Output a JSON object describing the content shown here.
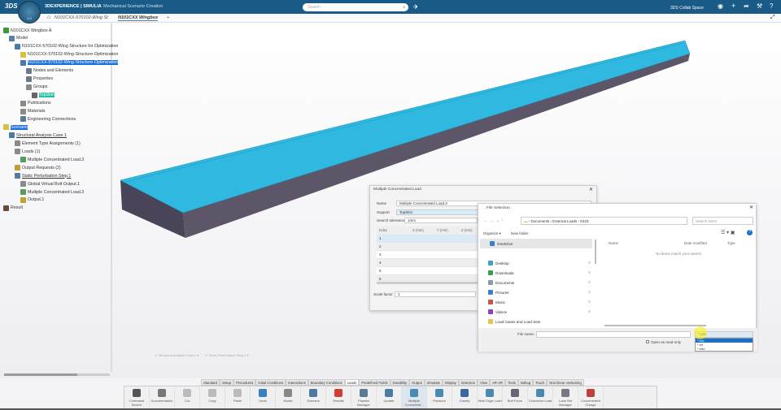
{
  "app": {
    "brand": "3DEXPERIENCE | SIMULIA",
    "subtitle": "Mechanical Scenario Creation",
    "search_placeholder": "Search",
    "space": "3DS Collab Space",
    "compass_version": "1.0"
  },
  "tabs": [
    {
      "label": "N101CXX-570102-Wing St"
    },
    {
      "label": "N101CXX Wingbox",
      "active": true
    },
    {
      "label": "+"
    }
  ],
  "tree": [
    {
      "label": "N101CXX Wingbox A",
      "level": 0,
      "color": "#3a9a3a"
    },
    {
      "label": "Model",
      "level": 1,
      "color": "#5a7fa8"
    },
    {
      "label": "N101CXX-570102-Wing Structure for Optimization",
      "level": 2,
      "color": "#4a7aa8"
    },
    {
      "label": "N101CXX-570102-Wing-Structure-Optimization",
      "level": 3,
      "color": "#d8c040"
    },
    {
      "label": "N101CXX-570102-Wing-Structure-Optimization",
      "level": 3,
      "color": "#4a7aa8",
      "selected": true
    },
    {
      "label": "Nodes and Elements",
      "level": 4,
      "color": "#6a7a8a"
    },
    {
      "label": "Properties",
      "level": 4,
      "color": "#6a7a8a"
    },
    {
      "label": "Groups",
      "level": 4,
      "color": "#8a8a8a"
    },
    {
      "label": "TopSkin",
      "level": 5,
      "color": "#666",
      "highlight": true
    },
    {
      "label": "Publications",
      "level": 3,
      "color": "#8a8a8a"
    },
    {
      "label": "Materials",
      "level": 3,
      "color": "#8a8a8a"
    },
    {
      "label": "Engineering Connections",
      "level": 3,
      "color": "#5a7a9a"
    },
    {
      "label": "Scenario",
      "level": 0,
      "color": "#d8c040",
      "selected": true
    },
    {
      "label": "Structural Analysis Case.1",
      "level": 1,
      "color": "#4a7aa8",
      "underline": true
    },
    {
      "label": "Element Type Assignments (1)",
      "level": 2,
      "color": "#8a8a8a"
    },
    {
      "label": "Loads (1)",
      "level": 2,
      "color": "#8a8a8a"
    },
    {
      "label": "Multiple Concentrated Load.3",
      "level": 3,
      "color": "#5a9a5a"
    },
    {
      "label": "Output Requests (2)",
      "level": 2,
      "color": "#c0a030"
    },
    {
      "label": "Static Perturbation Step.1",
      "level": 2,
      "color": "#5a7a9a",
      "underline": true
    },
    {
      "label": "Global Virtual Bolt Output.1",
      "level": 3,
      "color": "#8a8a8a"
    },
    {
      "label": "Multiple Concentrated Load.3",
      "level": 3,
      "color": "#5a9a5a"
    },
    {
      "label": "Output.1",
      "level": 3,
      "color": "#c0a030"
    },
    {
      "label": "Result",
      "level": 0,
      "color": "#6a4a3a"
    }
  ],
  "mcl_dialog": {
    "title": "Multiple Concentrated Load",
    "name_label": "Name",
    "name_value": "Multiple Concentrated Load.3",
    "support_label": "Support",
    "support_value": "TopSkin",
    "tol_label": "Search tolerance",
    "tol_value": "1mm",
    "columns": [
      "Index",
      "X (mm)",
      "Y (mm)",
      "Z (mm)"
    ],
    "rows": [
      "1",
      "2",
      "3",
      "4",
      "5",
      "6"
    ],
    "scale_label": "Scale factor",
    "scale_value": "1"
  },
  "file_dialog": {
    "title": "File Selection",
    "path": [
      "Documents",
      "External Loads",
      "N101"
    ],
    "search_placeholder": "Search N101",
    "organize": "Organize ▾",
    "new_folder": "New folder",
    "nav": [
      {
        "label": "OneDrive",
        "color": "#3a7fd0"
      },
      {
        "label": "Desktop",
        "color": "#3aa0d0"
      },
      {
        "label": "Downloads",
        "color": "#3aa050"
      },
      {
        "label": "Documents",
        "color": "#8a9aaa"
      },
      {
        "label": "Pictures",
        "color": "#3a7fd0"
      },
      {
        "label": "Music",
        "color": "#d05040"
      },
      {
        "label": "Videos",
        "color": "#8a40c0"
      },
      {
        "label": "Load Cases and Load Sets",
        "color": "#e8c050"
      }
    ],
    "columns": [
      "Name",
      "Date modified",
      "Type"
    ],
    "empty_msg": "No items match your search.",
    "filename_label": "File name:",
    "filename_value": "",
    "filetype_value": "*.csv",
    "filetype_options": [
      "*.csv",
      "*.txt",
      "*.xlsx"
    ],
    "readonly_label": "Open as read-only"
  },
  "status_chips": [
    "Structural Analysis Case.1",
    "Static Perturbation Step.1"
  ],
  "ribbon_tabs": [
    "Standard",
    "Setup",
    "Procedures",
    "Initial Conditions",
    "Interactions",
    "Boundary Conditions",
    "Loads",
    "Predefined Fields",
    "Durability",
    "Output",
    "Simulate",
    "Display",
    "Selection",
    "View",
    "AR-VR",
    "Tools",
    "Debug",
    "Touch",
    "Non linear versioning"
  ],
  "ribbon_active": "Loads",
  "tools": [
    {
      "label": "Command Search",
      "color": "#555"
    },
    {
      "label": "Documentation",
      "color": "#777"
    },
    {
      "label": "Cut",
      "color": "#bbb"
    },
    {
      "label": "Copy",
      "color": "#bbb"
    },
    {
      "label": "Paste",
      "color": "#bbb"
    },
    {
      "label": "Undo",
      "color": "#3a7fc0"
    },
    {
      "label": "Model",
      "color": "#888"
    },
    {
      "label": "Scenario",
      "color": "#4a7aa8"
    },
    {
      "label": "Results",
      "color": "#d04030"
    },
    {
      "label": "Physics Manager",
      "color": "#5a7a9a"
    },
    {
      "label": "Update",
      "color": "#4a7aa8"
    },
    {
      "label": "Multiple Concentrat...",
      "color": "#4a8ab0"
    },
    {
      "label": "Pressure",
      "color": "#4a8ab0"
    },
    {
      "label": "Gravity",
      "color": "#3a6aa0"
    },
    {
      "label": "Shell Edge Load",
      "color": "#4a8ab0"
    },
    {
      "label": "Bolt Force",
      "color": "#667"
    },
    {
      "label": "Connector Load",
      "color": "#4a8ab0"
    },
    {
      "label": "Load Set Manager",
      "color": "#778"
    },
    {
      "label": "Concentrated Charge",
      "color": "#c04040"
    }
  ]
}
